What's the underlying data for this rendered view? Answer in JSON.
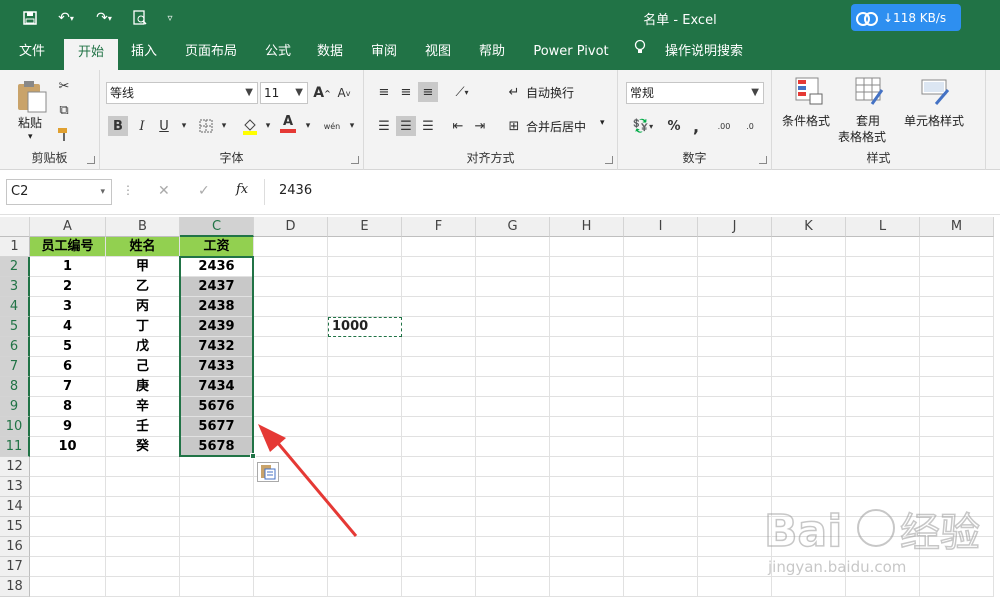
{
  "window": {
    "title": "名单  -  Excel"
  },
  "network_speed": "↓118 KB/s",
  "menu": {
    "file": "文件",
    "home": "开始",
    "insert": "插入",
    "layout": "页面布局",
    "formulas": "公式",
    "data": "数据",
    "review": "审阅",
    "view": "视图",
    "help": "帮助",
    "powerpivot": "Power Pivot",
    "search": "操作说明搜索"
  },
  "ribbon": {
    "clipboard": {
      "label": "剪贴板",
      "paste": "粘贴"
    },
    "font": {
      "label": "字体",
      "name": "等线",
      "size": "11",
      "bold": "B",
      "italic": "I",
      "underline": "U",
      "grow": "A",
      "shrink": "A",
      "color_letter": "A",
      "phonetic": "wén"
    },
    "align": {
      "label": "对齐方式",
      "wrap": "自动换行",
      "merge": "合并后居中"
    },
    "number": {
      "label": "数字",
      "format": "常规",
      "percent": "%",
      "comma": ",",
      "inc_dec": ".00",
      "dec_dec": ".0"
    },
    "styles": {
      "label": "样式",
      "conditional": "条件格式",
      "table": "套用",
      "table2": "表格格式",
      "cell": "单元格样式"
    }
  },
  "formula_bar": {
    "name_box": "C2",
    "formula": "2436",
    "cancel": "✕",
    "enter": "✓",
    "fx": "fx"
  },
  "columns": [
    "A",
    "B",
    "C",
    "D",
    "E",
    "F",
    "G",
    "H",
    "I",
    "J",
    "K",
    "L",
    "M"
  ],
  "rows": [
    "1",
    "2",
    "3",
    "4",
    "5",
    "6",
    "7",
    "8",
    "9",
    "10",
    "11",
    "12",
    "13",
    "14",
    "15",
    "16",
    "17",
    "18"
  ],
  "table": {
    "headers": [
      "员工编号",
      "姓名",
      "工资"
    ],
    "rows": [
      [
        "1",
        "甲",
        "2436"
      ],
      [
        "2",
        "乙",
        "2437"
      ],
      [
        "3",
        "丙",
        "2438"
      ],
      [
        "4",
        "丁",
        "2439"
      ],
      [
        "5",
        "戊",
        "7432"
      ],
      [
        "6",
        "己",
        "7433"
      ],
      [
        "7",
        "庚",
        "7434"
      ],
      [
        "8",
        "辛",
        "5676"
      ],
      [
        "9",
        "壬",
        "5677"
      ],
      [
        "10",
        "癸",
        "5678"
      ]
    ]
  },
  "copied_cell": {
    "ref": "E5",
    "value": "1000"
  },
  "watermark": {
    "brand": "Baidu经验",
    "url": "jingyan.baidu.com"
  },
  "colors": {
    "excel_green": "#217346",
    "header_fill": "#92d050",
    "selection_fill": "#c8c8c8",
    "arrow": "#e53935"
  }
}
